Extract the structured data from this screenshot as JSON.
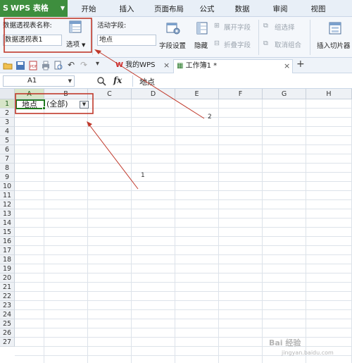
{
  "app": {
    "name": "WPS 表格",
    "logo": "S"
  },
  "menu": {
    "tabs": [
      "开始",
      "插入",
      "页面布局",
      "公式",
      "数据",
      "审阅",
      "视图"
    ]
  },
  "ribbon": {
    "pivot_name_label": "数据透视表名称:",
    "pivot_name_value": "数据透视表1",
    "options_label": "选项",
    "active_field_label": "活动字段:",
    "active_field_value": "地点",
    "field_settings": "字段设置",
    "hide": "隐藏",
    "expand_field": "展开字段",
    "collapse_field": "折叠字段",
    "group_selection": "组选择",
    "ungroup": "取消组合",
    "insert_slicer": "插入切片器"
  },
  "doc_tabs": {
    "my_wps": "我的WPS",
    "workbook": "工作簿1 *"
  },
  "formula_bar": {
    "name_box": "A1",
    "fx": "fx",
    "content": "地点"
  },
  "sheet": {
    "columns": [
      "A",
      "B",
      "C",
      "D",
      "E",
      "F",
      "G",
      "H"
    ],
    "rows": [
      "1",
      "2",
      "3",
      "4",
      "5",
      "6",
      "7",
      "8",
      "9",
      "10",
      "11",
      "12",
      "13",
      "14",
      "15",
      "16",
      "17",
      "18",
      "19",
      "20",
      "21",
      "22",
      "23",
      "24",
      "25",
      "26",
      "27"
    ],
    "cell_a1": "地点",
    "cell_b1": "(全部)"
  },
  "annotations": {
    "label_1": "1",
    "label_2": "2"
  },
  "watermark": {
    "main": "Bai 经验",
    "sub": "jingyan.baidu.com"
  },
  "colors": {
    "accent_green": "#3e8e3e",
    "annotation_red": "#c0392b",
    "selection_border": "#1d7a1d"
  }
}
